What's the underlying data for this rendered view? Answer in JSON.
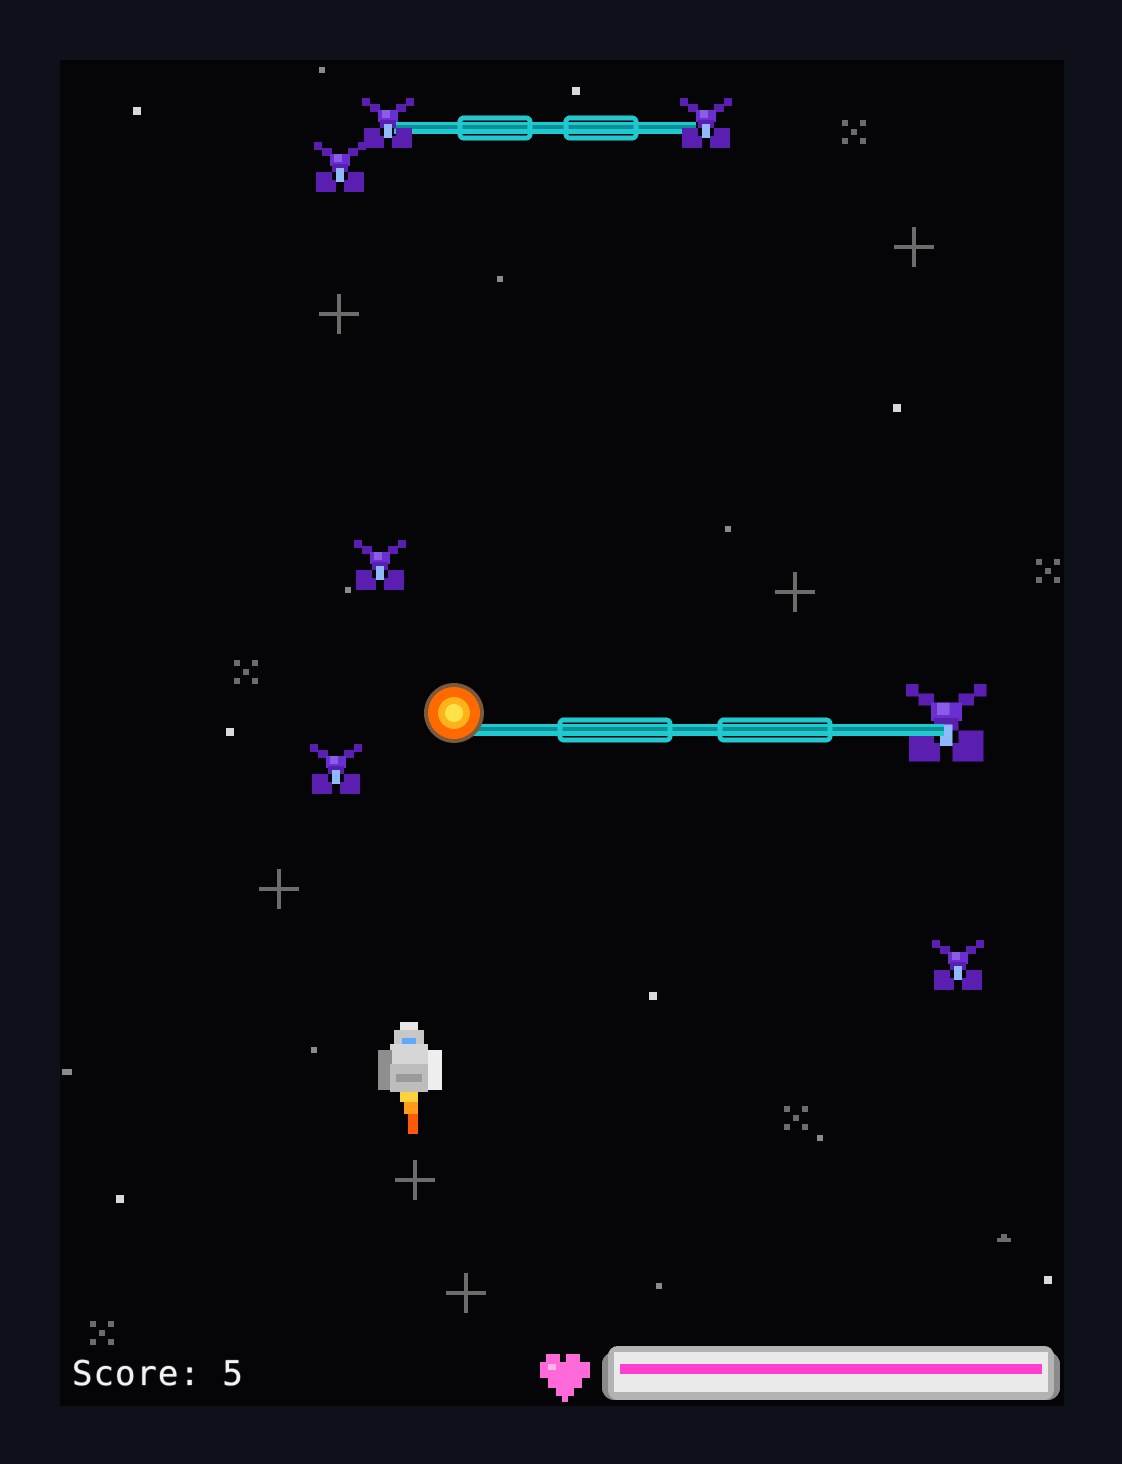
{
  "hud": {
    "score_label": "Score:",
    "score_value": "5",
    "health_fraction": 1.0,
    "heart_icon": "heart-icon"
  },
  "colors": {
    "page_bg": "#0e111a",
    "space_bg": "#050508",
    "enemy": "#5a1fb0",
    "enemy_light": "#8a5ce8",
    "enemy_core": "#8fb8ff",
    "beam": "#1fc9d0",
    "fireball_outer": "#ff6a00",
    "fireball_inner": "#ffe24a",
    "player_body": "#c7c7c7",
    "player_window": "#5fa8ff",
    "health_fill": "#ff3fd0",
    "health_frame": "#9a9a9a",
    "heart": "#ff6ad8"
  },
  "sprites": {
    "enemies": 8,
    "beams": 2,
    "fireballs": 1,
    "player_ships": 1
  }
}
